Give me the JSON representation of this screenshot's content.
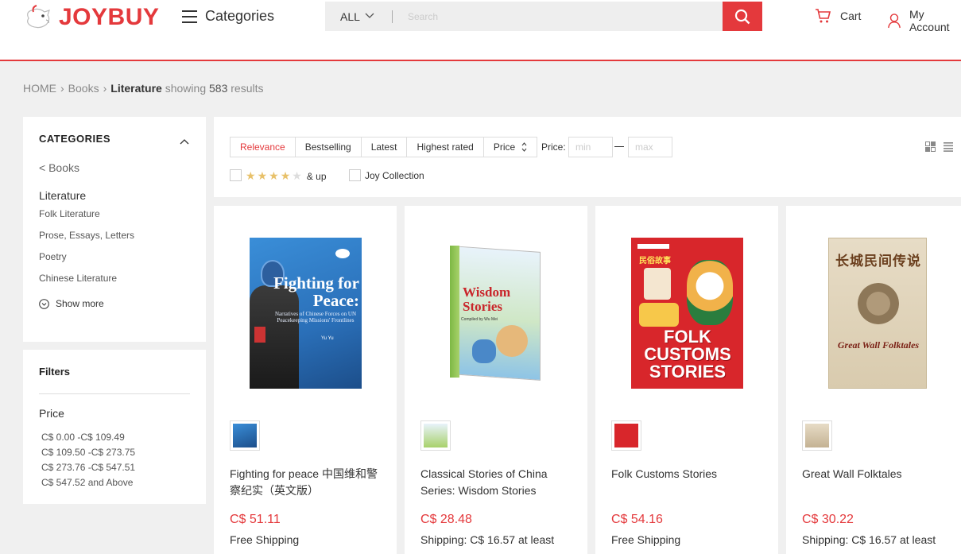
{
  "header": {
    "logo_text": "JOYBUY",
    "categories_label": "Categories",
    "search_scope": "ALL",
    "search_placeholder": "Search",
    "cart_label": "Cart",
    "account_label": "My Account"
  },
  "breadcrumb": {
    "home": "HOME",
    "books": "Books",
    "current": "Literature",
    "showing": "showing",
    "count": "583",
    "results": "results"
  },
  "sidebar": {
    "categories_title": "CATEGORIES",
    "back_label": "< Books",
    "current_category": "Literature",
    "subcategories": [
      "Folk Literature",
      "Prose, Essays, Letters",
      "Poetry",
      "Chinese Literature"
    ],
    "show_more": "Show more",
    "filters_title": "Filters",
    "price_title": "Price",
    "price_ranges": [
      "C$ 0.00 -C$ 109.49",
      "C$ 109.50 -C$ 273.75",
      "C$ 273.76 -C$ 547.51",
      "C$ 547.52 and Above"
    ]
  },
  "sortbar": {
    "tabs": [
      "Relevance",
      "Bestselling",
      "Latest",
      "Highest rated",
      "Price"
    ],
    "active_tab": "Relevance",
    "price_label": "Price:",
    "min_placeholder": "min",
    "max_placeholder": "max",
    "rating_filter_label": "& up",
    "rating_stars": 4,
    "joy_collection": "Joy Collection"
  },
  "products": [
    {
      "name": "Fighting for peace 中国维和警察纪实（英文版）",
      "price": "C$ 51.11",
      "shipping": "Free Shipping",
      "cover_title": "Fighting for Peace:",
      "cover_subtitle": "Narratives of Chinese Forces on UN Peacekeeping Missions' Frontlines",
      "cover_author": "Yu Yu"
    },
    {
      "name": "Classical Stories of China Series: Wisdom Stories",
      "price": "C$ 28.48",
      "shipping": "Shipping: C$ 16.57 at least",
      "cover_title": "Wisdom Stories",
      "cover_subtitle": "Compiled by Wu Mei"
    },
    {
      "name": "Folk Customs Stories",
      "price": "C$ 54.16",
      "shipping": "Free Shipping",
      "cover_title": "FOLK CUSTOMS STORIES",
      "cover_cn": "民俗故事"
    },
    {
      "name": "Great Wall Folktales",
      "price": "C$ 30.22",
      "shipping": "Shipping: C$ 16.57 at least",
      "cover_title": "Great Wall Folktales",
      "cover_cn": "长城民间传说"
    }
  ],
  "colors": {
    "brand": "#e4393c",
    "star": "#e8c16a",
    "background": "#f0f0f0"
  }
}
